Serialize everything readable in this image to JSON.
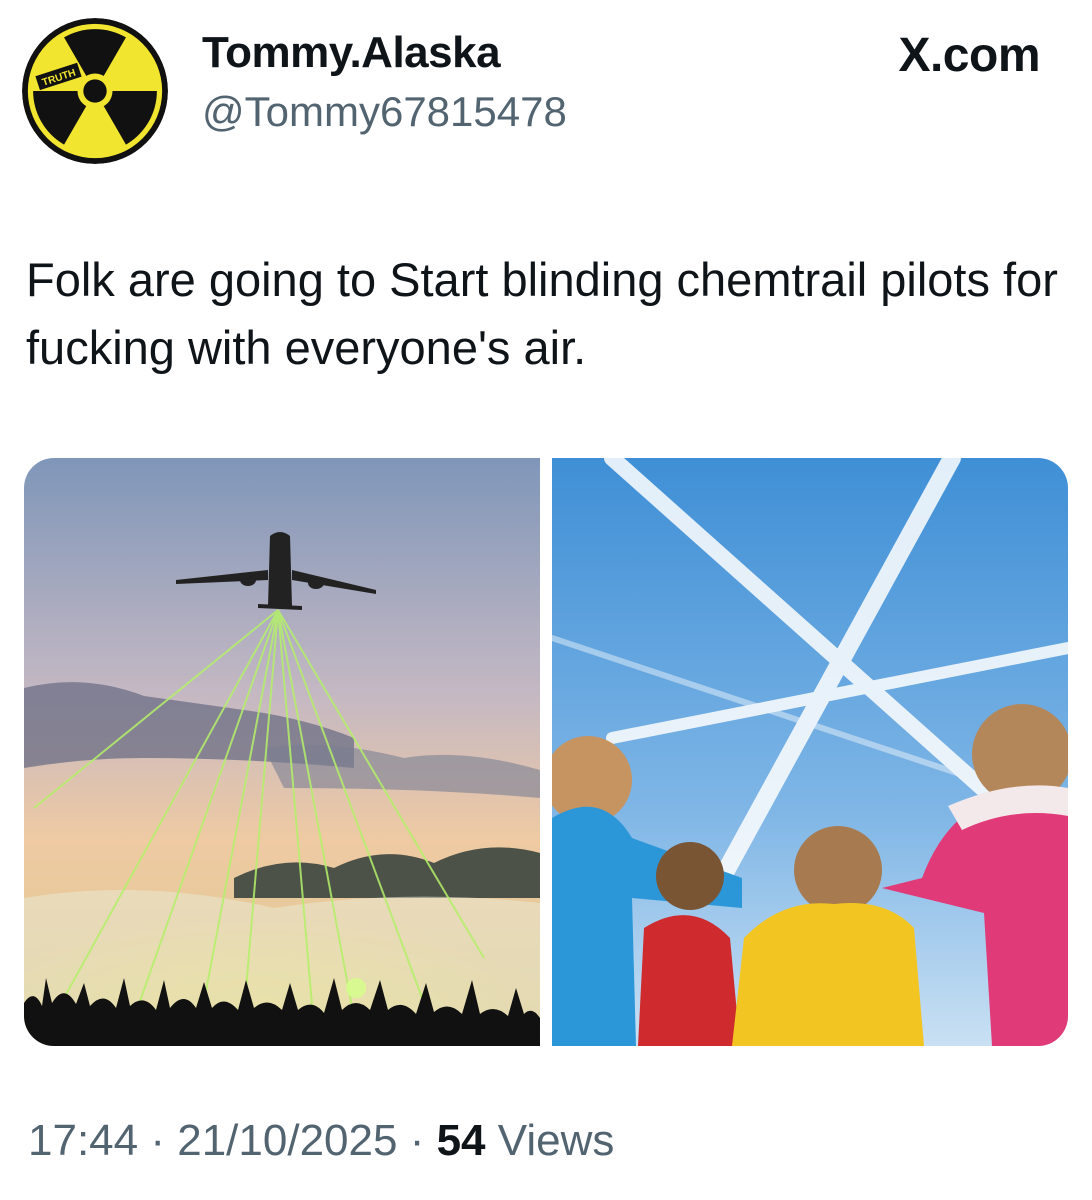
{
  "author": {
    "display_name": "Tommy.Alaska",
    "handle": "@Tommy67815478",
    "avatar_icon": "radiation-trefoil-icon",
    "avatar_badge_text": "TRUTH"
  },
  "source_label": "X.com",
  "post": {
    "text": "Folk are going to Start blinding chemtrail pilots for fucking with everyone's air."
  },
  "media": [
    {
      "name": "airplane-lasers-image"
    },
    {
      "name": "children-contrails-image"
    }
  ],
  "meta": {
    "time": "17:44",
    "separator": "·",
    "date": "21/10/2025",
    "views_count": "54",
    "views_label": "Views"
  },
  "colors": {
    "avatar_yellow": "#f2e530",
    "text_primary": "#0f1419",
    "text_secondary": "#536471"
  }
}
